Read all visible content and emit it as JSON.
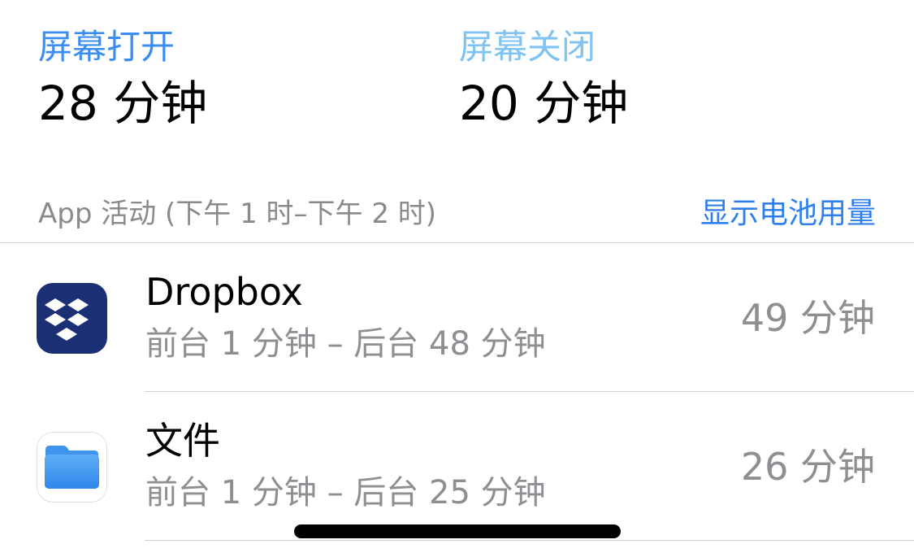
{
  "screen_on": {
    "label": "屏幕打开",
    "value": "28 分钟",
    "color": "#3b8ef0"
  },
  "screen_off": {
    "label": "屏幕关闭",
    "value": "20 分钟",
    "color": "#7ec3f2"
  },
  "activity": {
    "title": "App 活动 (下午 1 时–下午 2 时)",
    "battery_link": "显示电池用量"
  },
  "apps": [
    {
      "name": "Dropbox",
      "icon": "dropbox-icon",
      "detail": "前台 1 分钟 – 后台 48 分钟",
      "total": "49 分钟"
    },
    {
      "name": "文件",
      "icon": "folder-icon",
      "detail": "前台 1 分钟 – 后台 25 分钟",
      "total": "26 分钟"
    }
  ]
}
